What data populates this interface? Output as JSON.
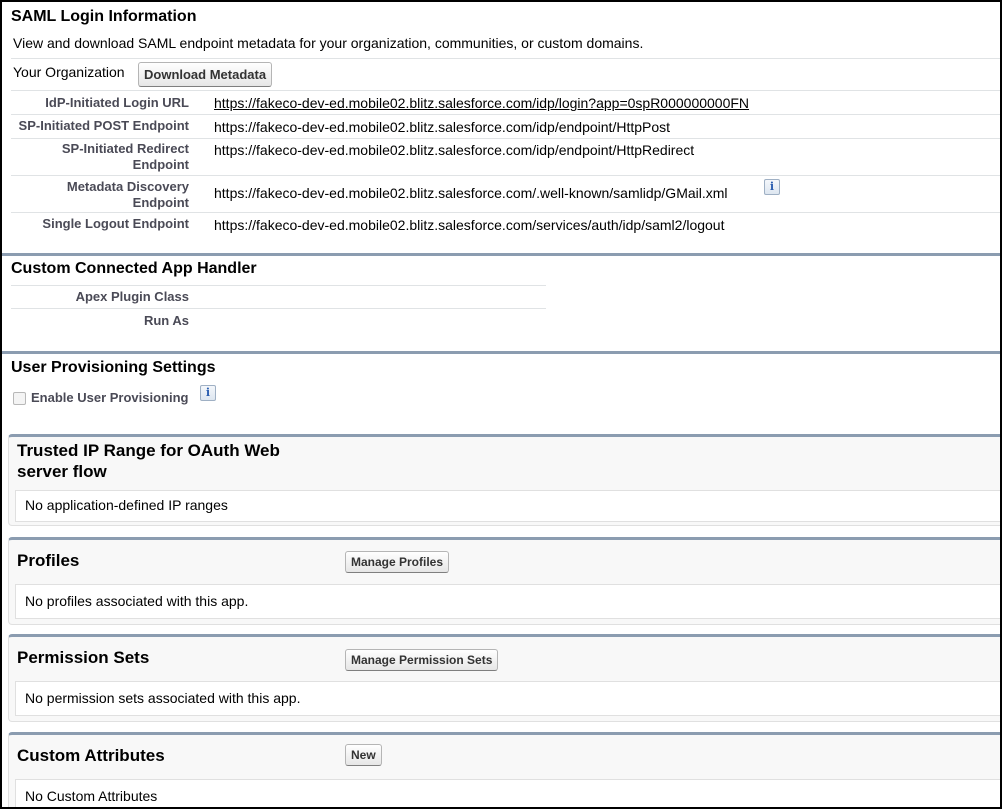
{
  "saml": {
    "title": "SAML Login Information",
    "description": "View and download SAML endpoint metadata for your organization, communities, or custom domains.",
    "org_label": "Your Organization",
    "download_button": "Download Metadata",
    "rows": [
      {
        "label": "IdP-Initiated Login URL",
        "value": "https://fakeco-dev-ed.mobile02.blitz.salesforce.com/idp/login?app=0spR000000000FN"
      },
      {
        "label": "SP-Initiated POST Endpoint",
        "value": "https://fakeco-dev-ed.mobile02.blitz.salesforce.com/idp/endpoint/HttpPost"
      },
      {
        "label_line1": "SP-Initiated Redirect",
        "label_line2": "Endpoint",
        "value": "https://fakeco-dev-ed.mobile02.blitz.salesforce.com/idp/endpoint/HttpRedirect"
      },
      {
        "label_line1": "Metadata Discovery",
        "label_line2": "Endpoint",
        "value": "https://fakeco-dev-ed.mobile02.blitz.salesforce.com/.well-known/samlidp/GMail.xml"
      },
      {
        "label": "Single Logout Endpoint",
        "value": "https://fakeco-dev-ed.mobile02.blitz.salesforce.com/services/auth/idp/saml2/logout"
      }
    ]
  },
  "handler": {
    "title": "Custom Connected App Handler",
    "apex_label": "Apex Plugin Class",
    "runas_label": "Run As"
  },
  "provisioning": {
    "title": "User Provisioning Settings",
    "checkbox_label": "Enable User Provisioning",
    "checked": false
  },
  "trusted_ip": {
    "title_line1": "Trusted IP Range for OAuth Web",
    "title_line2": "server flow",
    "empty_text": "No application-defined IP ranges"
  },
  "profiles": {
    "title": "Profiles",
    "button": "Manage Profiles",
    "empty_text": "No profiles associated with this app."
  },
  "permission_sets": {
    "title": "Permission Sets",
    "button": "Manage Permission Sets",
    "empty_text": "No permission sets associated with this app."
  },
  "custom_attributes": {
    "title": "Custom Attributes",
    "button": "New",
    "empty_text": "No Custom Attributes"
  },
  "icons": {
    "info": "info-icon",
    "info_glyph": "i"
  },
  "colors": {
    "section_band": "#8b9cb0",
    "label_text": "#4a4a56",
    "info_icon": "#2a5db0"
  }
}
